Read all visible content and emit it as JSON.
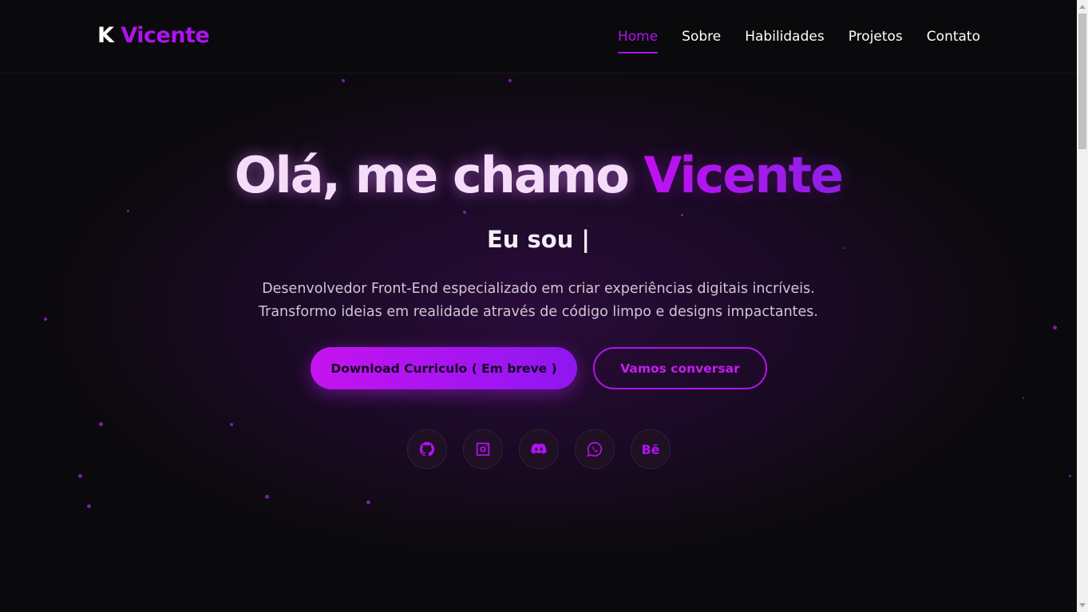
{
  "brand": {
    "initial": "K",
    "name": "Vicente"
  },
  "nav": {
    "items": [
      {
        "label": "Home",
        "active": true
      },
      {
        "label": "Sobre",
        "active": false
      },
      {
        "label": "Habilidades",
        "active": false
      },
      {
        "label": "Projetos",
        "active": false
      },
      {
        "label": "Contato",
        "active": false
      }
    ]
  },
  "hero": {
    "greeting": "Olá, me chamo ",
    "name": "Vicente",
    "subtitle": "Eu sou |",
    "description_lines": [
      "Desenvolvedor Front-End especializado em criar experiências digitais incríveis.",
      "Transformo ideias em realidade através de código limpo e designs impactantes."
    ],
    "primary_button": "Download Curriculo ( Em breve )",
    "secondary_button": "Vamos conversar"
  },
  "socials": [
    {
      "icon": "github-icon"
    },
    {
      "icon": "instagram-icon"
    },
    {
      "icon": "discord-icon"
    },
    {
      "icon": "whatsapp-icon"
    },
    {
      "icon": "behance-icon",
      "label": "Bē"
    }
  ],
  "colors": {
    "accent": "#b012f0",
    "background": "#0a090c",
    "text": "#ffffff"
  }
}
